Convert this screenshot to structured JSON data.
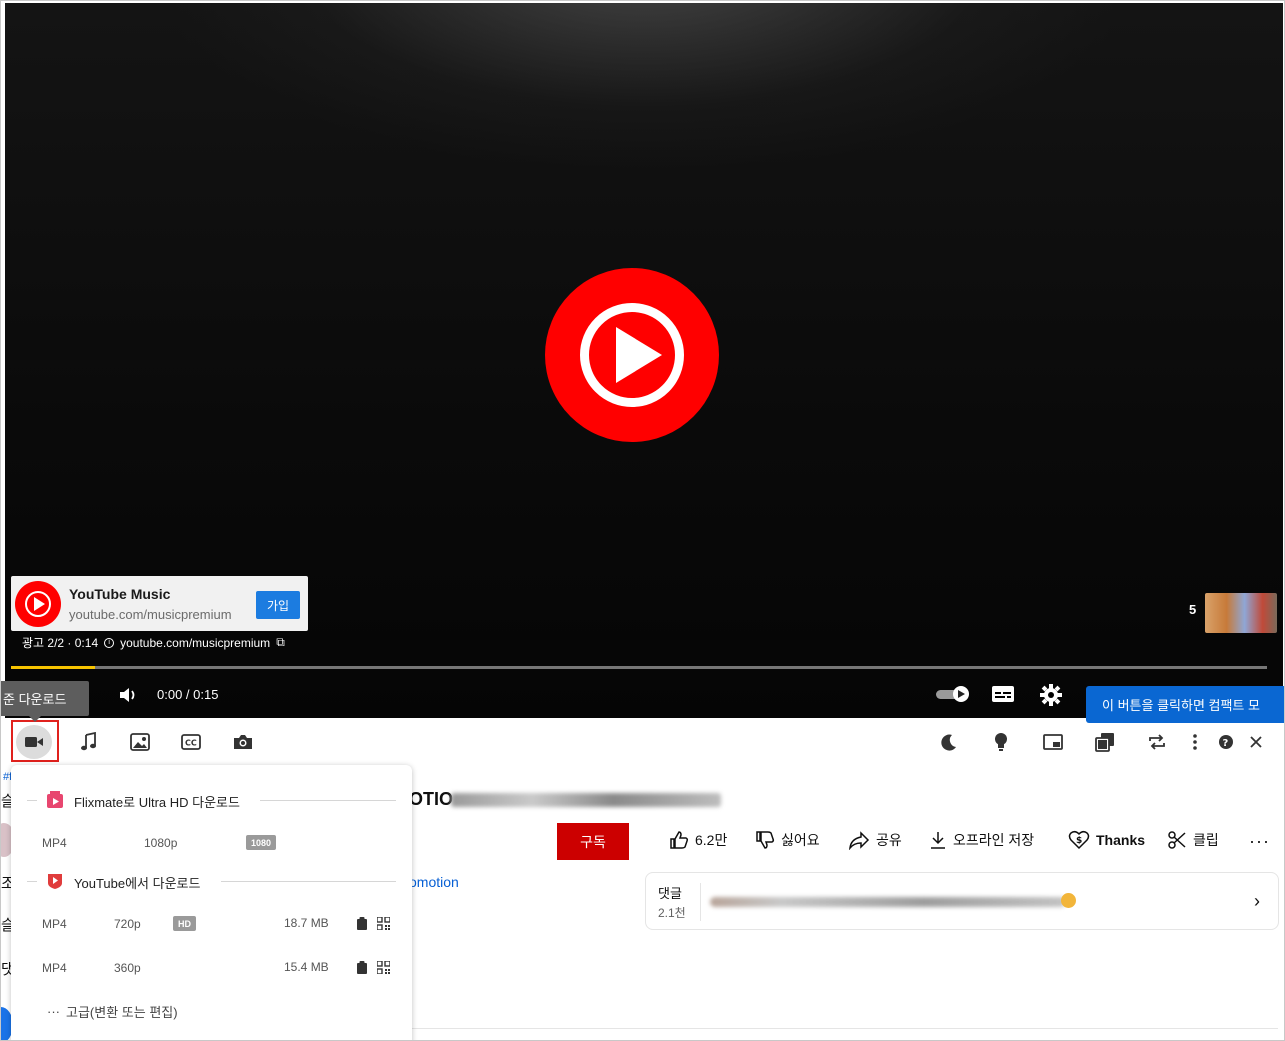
{
  "player": {
    "ad": {
      "title": "YouTube Music",
      "url": "youtube.com/musicpremium",
      "join_label": "가입",
      "meta_position": "광고 2/2 · 0:14",
      "meta_info": "i",
      "meta_url": "youtube.com/musicpremium",
      "meta_link": "⧉",
      "count": "5"
    },
    "progress_fraction": 0.067,
    "time": "0:00 / 0:15",
    "colors": {
      "brand_red": "#ff0000",
      "progress": "#f7c400"
    }
  },
  "tooltips": {
    "standard_download": "준 다운로드",
    "compact_mode": "이 버튼을 클릭하면 컴팩트 모"
  },
  "toolbar": {
    "left_icons": [
      "video-download-icon",
      "music-note-icon",
      "image-icon",
      "cc-icon",
      "camera-icon"
    ],
    "right_icons": [
      "moon-icon",
      "lightbulb-icon",
      "picture-in-picture-icon",
      "copy-window-icon",
      "repeat-icon",
      "more-vertical-icon",
      "help-icon",
      "close-icon"
    ]
  },
  "download_menu": {
    "flixmate": {
      "label": "Flixmate로 Ultra HD 다운로드",
      "rows": [
        {
          "format": "MP4",
          "quality": "1080p",
          "badge": "1080"
        }
      ]
    },
    "youtube": {
      "label": "YouTube에서 다운로드",
      "rows": [
        {
          "format": "MP4",
          "quality": "720p",
          "badge": "HD",
          "size": "18.7 MB"
        },
        {
          "format": "MP4",
          "quality": "360p",
          "size": "15.4 MB"
        }
      ]
    },
    "advanced_dots": "···",
    "advanced": "고급(변환 또는 편집)"
  },
  "page": {
    "hashtag": "#f",
    "title_fragment": "OTIO",
    "subscribe": "구독",
    "actions": {
      "likes": "6.2만",
      "dislike": "싫어요",
      "share": "공유",
      "offline": "오프라인 저장",
      "thanks": "Thanks",
      "clip": "클립",
      "more": "···"
    },
    "promo_link": "omotion",
    "comments": {
      "label": "댓글",
      "count": "2.1천",
      "chevron": "›"
    },
    "left_peek": [
      "슬",
      "조",
      "슬",
      "댓"
    ]
  }
}
